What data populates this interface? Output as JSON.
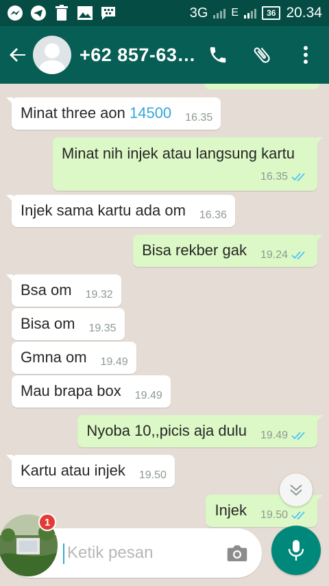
{
  "status_bar": {
    "network": "3G",
    "network2": "E",
    "battery": "36",
    "time": "20.34",
    "icons": [
      "messenger-icon",
      "telegram-icon",
      "trash-icon",
      "gallery-icon",
      "bbm-icon"
    ]
  },
  "header": {
    "contact_name": "+62 857-63…"
  },
  "messages": [
    {
      "dir": "in",
      "text": "Minat three aon ",
      "link": "14500",
      "time": "16.35"
    },
    {
      "dir": "out",
      "text": "Minat nih injek atau langsung kartu",
      "time": "16.35",
      "read": true
    },
    {
      "dir": "in",
      "text": "Injek sama kartu ada om",
      "time": "16.36"
    },
    {
      "dir": "out",
      "text": "Bisa rekber gak",
      "time": "19.24",
      "read": true
    },
    {
      "dir": "in",
      "text": "Bsa om",
      "time": "19.32"
    },
    {
      "dir": "in",
      "text": "Bisa om",
      "time": "19.35"
    },
    {
      "dir": "in",
      "text": "Gmna om",
      "time": "19.49"
    },
    {
      "dir": "in",
      "text": "Mau brapa box",
      "time": "19.49"
    },
    {
      "dir": "out",
      "text": "Nyoba 10,,picis aja dulu",
      "time": "19.49",
      "read": true
    },
    {
      "dir": "in",
      "text": "Kartu atau injek",
      "time": "19.50"
    },
    {
      "dir": "out",
      "text": "Injek",
      "time": "19.50",
      "read": true
    }
  ],
  "composer": {
    "placeholder": "Ketik pesan"
  },
  "chathead": {
    "badge_count": "1"
  },
  "colors": {
    "status_bar": "#054d44",
    "app_bar": "#075e54",
    "chat_bg": "#e5ddd5",
    "outgoing_bubble": "#dcf8c6",
    "incoming_bubble": "#ffffff",
    "read_ticks": "#4fc3f7",
    "mic_button": "#00897b",
    "link": "#34a7d9"
  }
}
